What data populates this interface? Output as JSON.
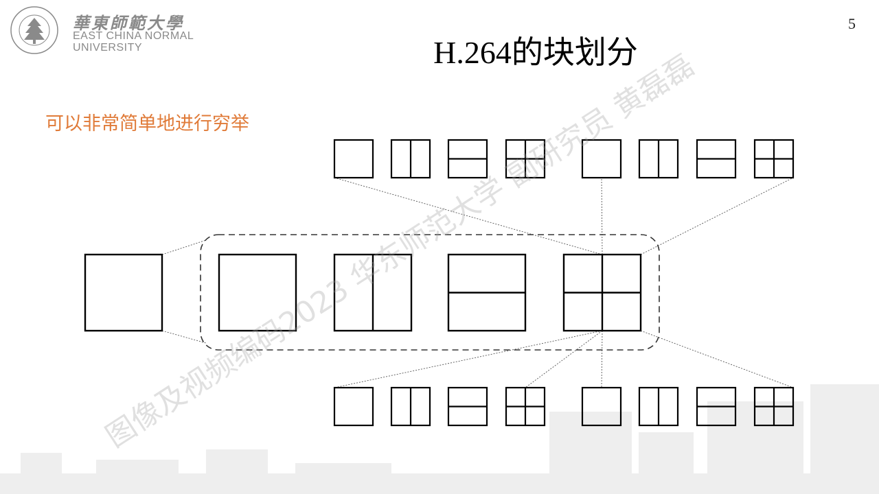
{
  "header": {
    "logo_cn": "華東師範大學",
    "logo_en_line1": "EAST CHINA NORMAL",
    "logo_en_line2": "UNIVERSITY",
    "seal_text": "EAST CHINA NORMAL UNIVERSITY",
    "page_number": "5"
  },
  "title": "H.264的块划分",
  "subtitle": "可以非常简单地进行穷举",
  "watermark": "图像及视频编码2023 华东师范大学 副研究员 黄磊磊",
  "diagram": {
    "nodes": [
      {
        "id": "top-1",
        "partition": "full"
      },
      {
        "id": "top-2",
        "partition": "vertical-split"
      },
      {
        "id": "top-3",
        "partition": "horizontal-split"
      },
      {
        "id": "top-4",
        "partition": "quad"
      },
      {
        "id": "top-5",
        "partition": "full"
      },
      {
        "id": "top-6",
        "partition": "vertical-split"
      },
      {
        "id": "top-7",
        "partition": "horizontal-split"
      },
      {
        "id": "top-8",
        "partition": "quad"
      },
      {
        "id": "root",
        "partition": "full"
      },
      {
        "id": "mid-1",
        "partition": "full"
      },
      {
        "id": "mid-2",
        "partition": "vertical-split"
      },
      {
        "id": "mid-3",
        "partition": "horizontal-split"
      },
      {
        "id": "mid-4",
        "partition": "quad"
      },
      {
        "id": "bot-1",
        "partition": "full"
      },
      {
        "id": "bot-2",
        "partition": "vertical-split"
      },
      {
        "id": "bot-3",
        "partition": "horizontal-split"
      },
      {
        "id": "bot-4",
        "partition": "quad"
      },
      {
        "id": "bot-5",
        "partition": "full"
      },
      {
        "id": "bot-6",
        "partition": "vertical-split"
      },
      {
        "id": "bot-7",
        "partition": "horizontal-split"
      },
      {
        "id": "bot-8",
        "partition": "quad"
      }
    ],
    "groups": [
      {
        "id": "middle-options",
        "members": [
          "mid-1",
          "mid-2",
          "mid-3",
          "mid-4"
        ],
        "style": "dashed-rounded"
      }
    ],
    "edges": [
      {
        "from": "root",
        "to": "middle-options",
        "style": "dotted"
      },
      {
        "from": "mid-4",
        "to": "top-1",
        "style": "dotted"
      },
      {
        "from": "mid-4",
        "to": "top-5",
        "style": "dotted"
      },
      {
        "from": "mid-4",
        "to": "top-8",
        "style": "dotted"
      },
      {
        "from": "mid-4",
        "to": "bot-1",
        "style": "dotted"
      },
      {
        "from": "mid-4",
        "to": "bot-4",
        "style": "dotted"
      },
      {
        "from": "mid-4",
        "to": "bot-5",
        "style": "dotted"
      },
      {
        "from": "mid-4",
        "to": "bot-8",
        "style": "dotted"
      }
    ]
  }
}
